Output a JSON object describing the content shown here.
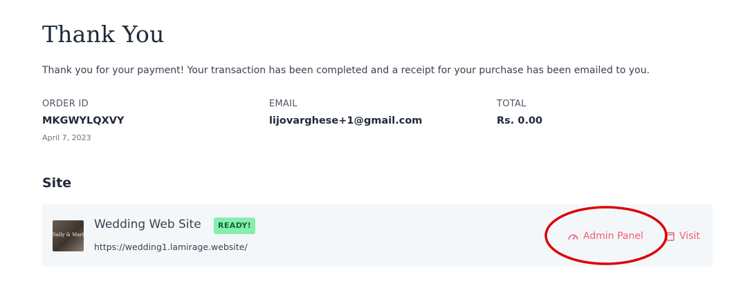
{
  "page": {
    "title": "Thank You",
    "message": "Thank you for your payment! Your transaction has been completed and a receipt for your purchase has been emailed to you."
  },
  "order": {
    "order_id_label": "ORDER ID",
    "order_id": "MKGWYLQXVY",
    "date": "April 7, 2023",
    "email_label": "EMAIL",
    "email": "lijovarghese+1@gmail.com",
    "total_label": "TOTAL",
    "total": "Rs. 0.00"
  },
  "site_section": {
    "title": "Site",
    "site": {
      "thumbnail_text": "Sally & Mark",
      "name": "Wedding Web Site",
      "status_badge": "READY!",
      "url": "https://wedding1.lamirage.website/",
      "admin_label": "Admin Panel",
      "admin_icon": "speedometer-icon",
      "visit_label": "Visit",
      "visit_icon": "external-window-icon"
    }
  },
  "colors": {
    "accent": "#f25c79",
    "badge_bg": "#86efac",
    "badge_text": "#166534",
    "card_bg": "#f4f7fa",
    "annotation": "#dd0000"
  }
}
